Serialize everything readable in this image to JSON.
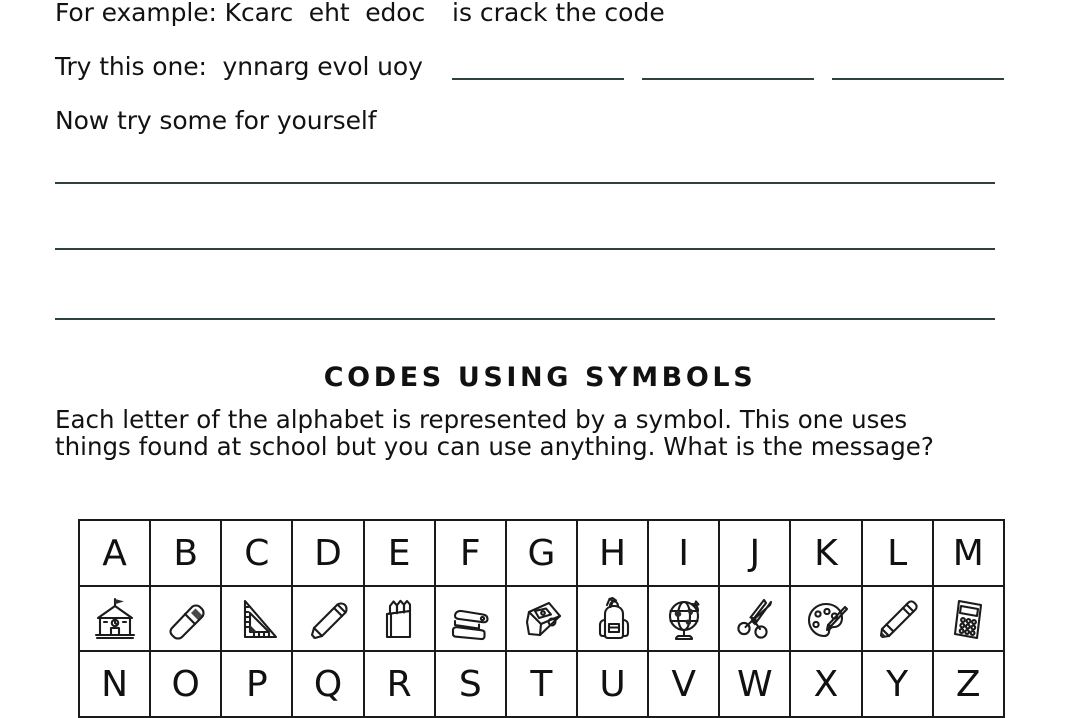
{
  "exercise": {
    "line1_prompt": "For example: Kcarc  eht  edoc",
    "line1_answer": "is crack the code",
    "line2_prompt": "Try this one:  ynnarg evol uoy",
    "line3_prompt": "Now try some for yourself",
    "blank_count": 3,
    "rule_count": 3,
    "line_color": "#2e4040"
  },
  "section": {
    "title": "CODES USING SYMBOLS",
    "intro": "Each letter of the alphabet is represented by a symbol. This one uses things found at school but you can use anything. What is the message?"
  },
  "cipher_table": {
    "row1_letters": [
      "A",
      "B",
      "C",
      "D",
      "E",
      "F",
      "G",
      "H",
      "I",
      "J",
      "K",
      "L",
      "M"
    ],
    "row1_symbols": [
      "school-building-icon",
      "eraser-icon",
      "set-square-ruler-icon",
      "pen-icon",
      "crayon-box-icon",
      "stapler-icon",
      "pencil-sharpener-icon",
      "backpack-icon",
      "globe-icon",
      "scissors-icon",
      "paint-palette-icon",
      "highlighter-marker-icon",
      "calculator-icon"
    ],
    "row2_letters": [
      "N",
      "O",
      "P",
      "Q",
      "R",
      "S",
      "T",
      "U",
      "V",
      "W",
      "X",
      "Y",
      "Z"
    ],
    "border_color": "#1a1a1a"
  }
}
